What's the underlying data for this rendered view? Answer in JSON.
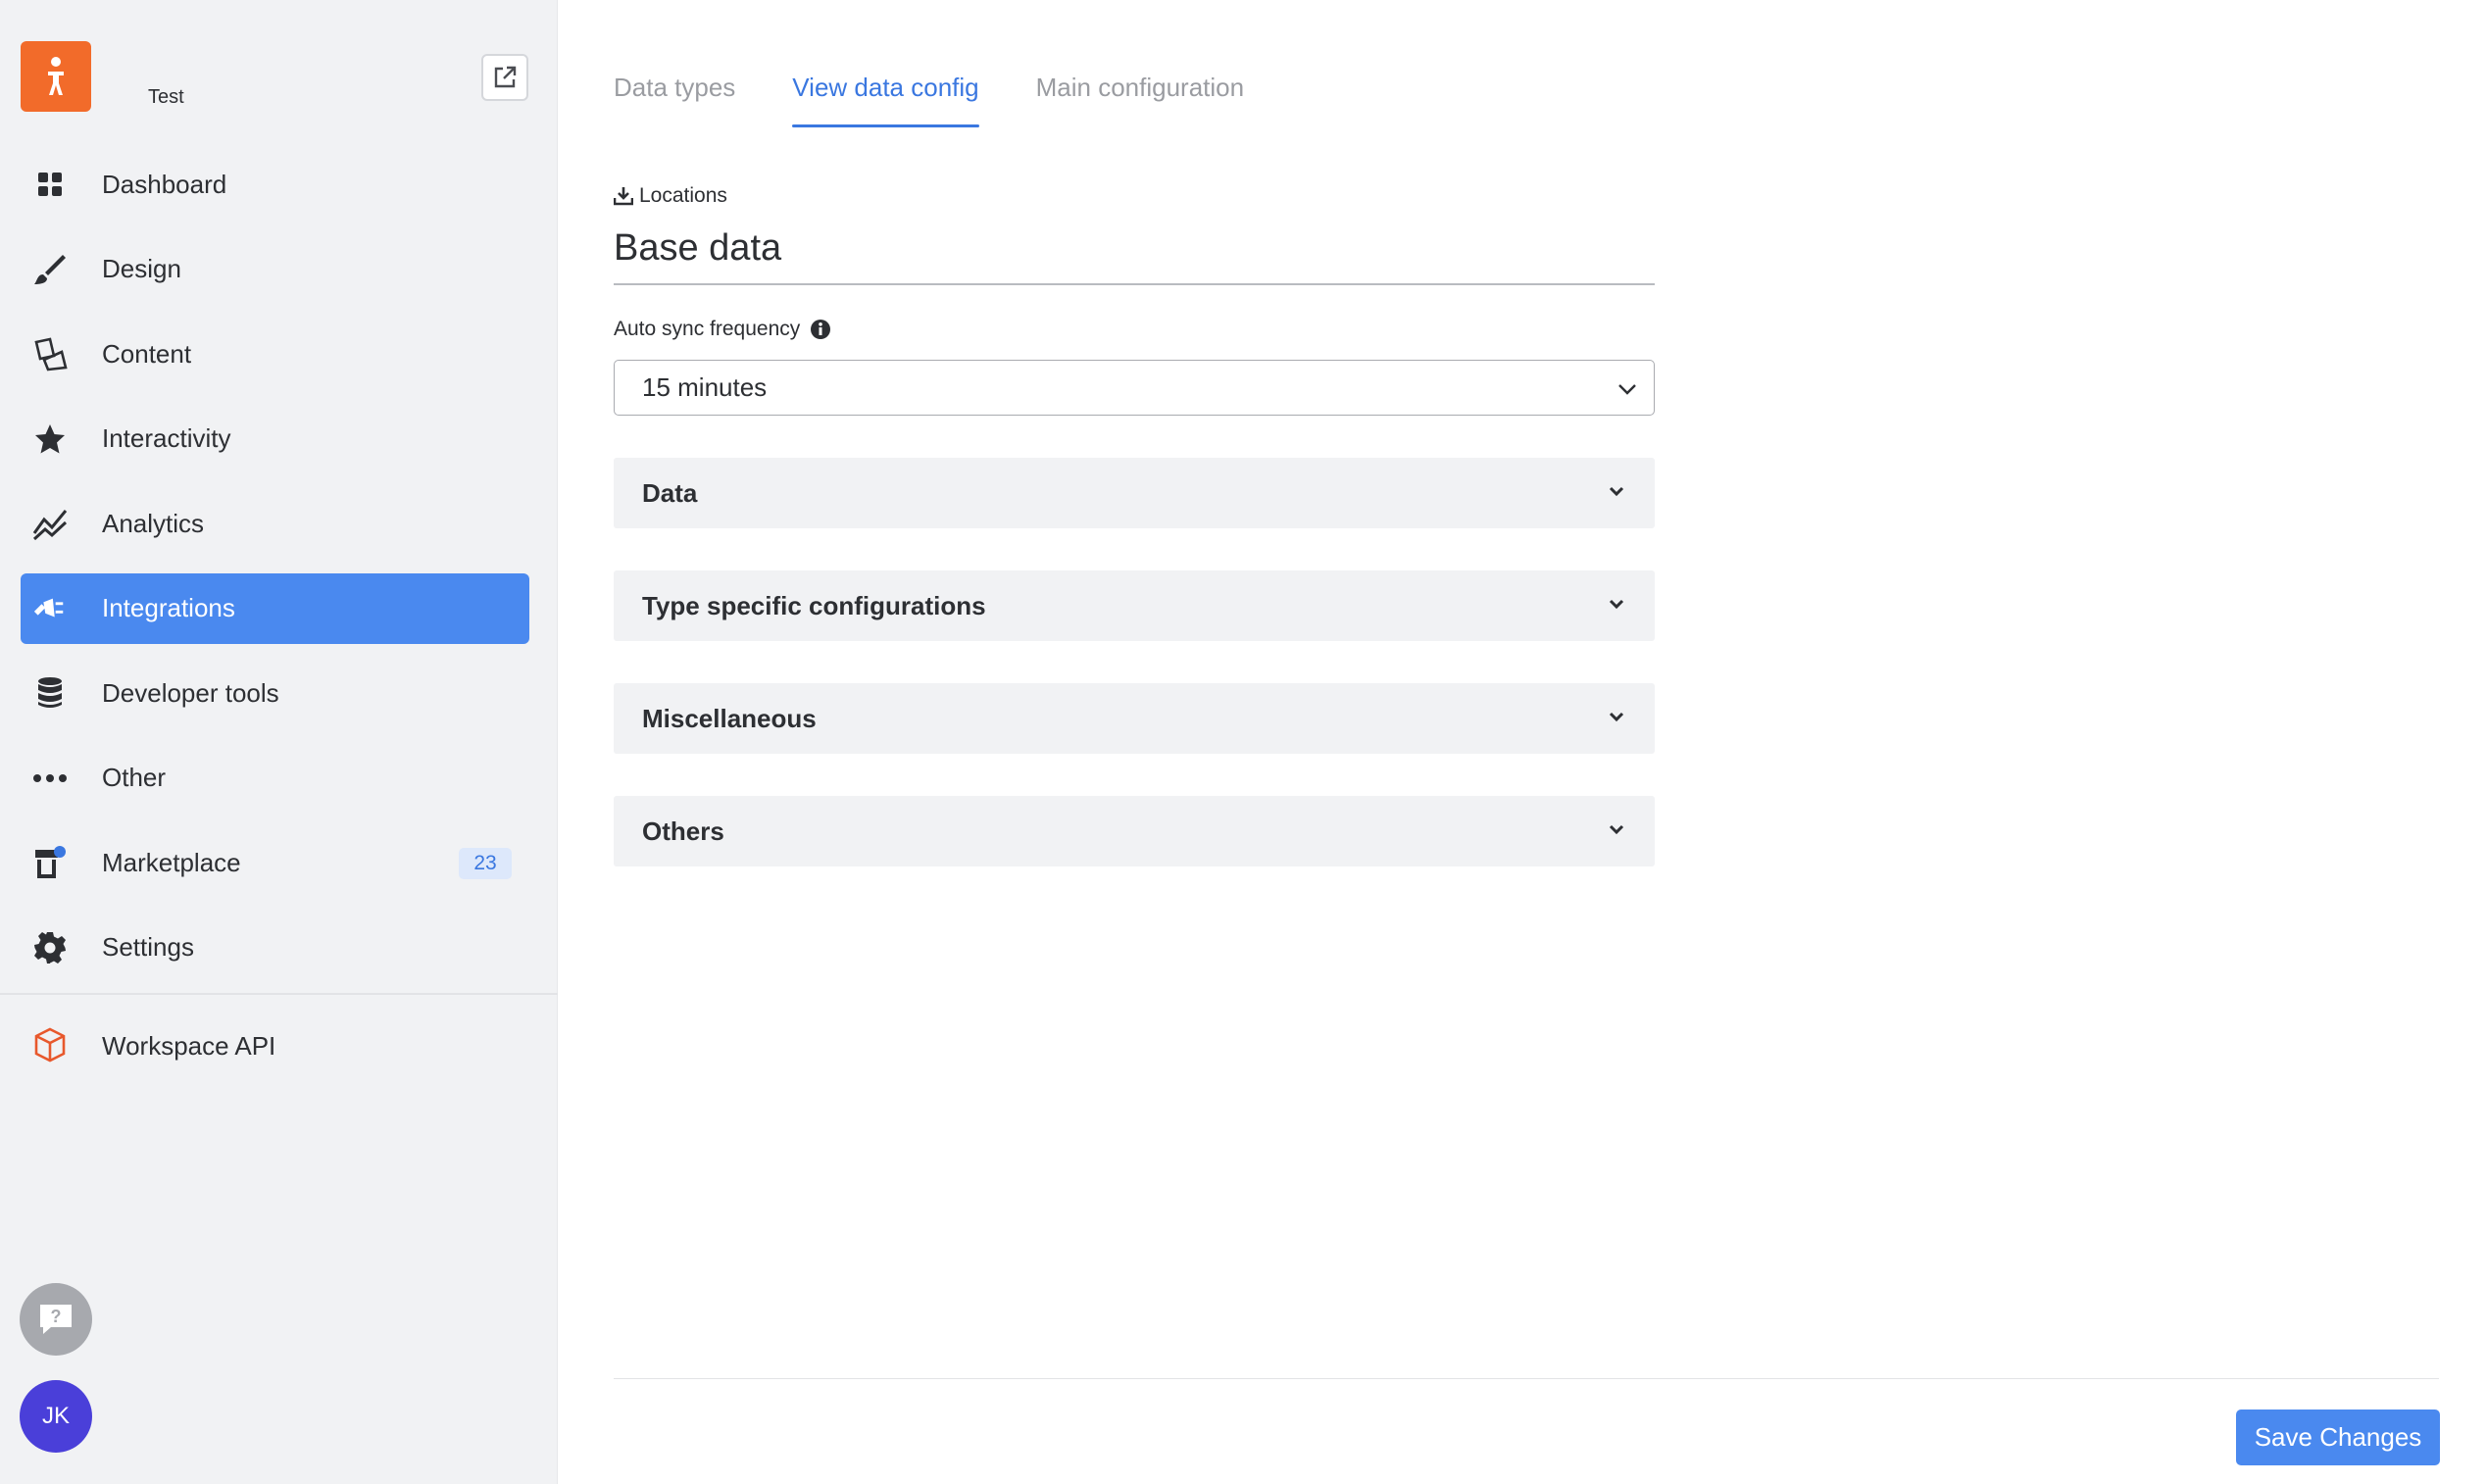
{
  "app": {
    "name": "Test",
    "accent": "#4a89ef",
    "logo_color": "#f26b2a"
  },
  "sidebar": {
    "items": [
      {
        "label": "Dashboard",
        "icon": "grid-icon"
      },
      {
        "label": "Design",
        "icon": "brush-icon"
      },
      {
        "label": "Content",
        "icon": "content-icon"
      },
      {
        "label": "Interactivity",
        "icon": "star-icon"
      },
      {
        "label": "Analytics",
        "icon": "chart-icon"
      },
      {
        "label": "Integrations",
        "icon": "plug-icon",
        "active": true
      },
      {
        "label": "Developer tools",
        "icon": "database-icon"
      },
      {
        "label": "Other",
        "icon": "more-icon"
      },
      {
        "label": "Marketplace",
        "icon": "store-icon",
        "badge": "23"
      },
      {
        "label": "Settings",
        "icon": "gear-icon"
      }
    ],
    "workspace_api": {
      "label": "Workspace API",
      "icon": "cube-icon"
    },
    "user_initials": "JK"
  },
  "tabs": [
    {
      "label": "Data types",
      "active": false
    },
    {
      "label": "View data config",
      "active": true
    },
    {
      "label": "Main configuration",
      "active": false
    }
  ],
  "form": {
    "location_label": "Locations",
    "title": "Base data",
    "sync_label": "Auto sync frequency",
    "sync_value": "15 minutes"
  },
  "sections": [
    "Data",
    "Type specific configurations",
    "Miscellaneous",
    "Others"
  ],
  "footer": {
    "save_label": "Save Changes"
  }
}
